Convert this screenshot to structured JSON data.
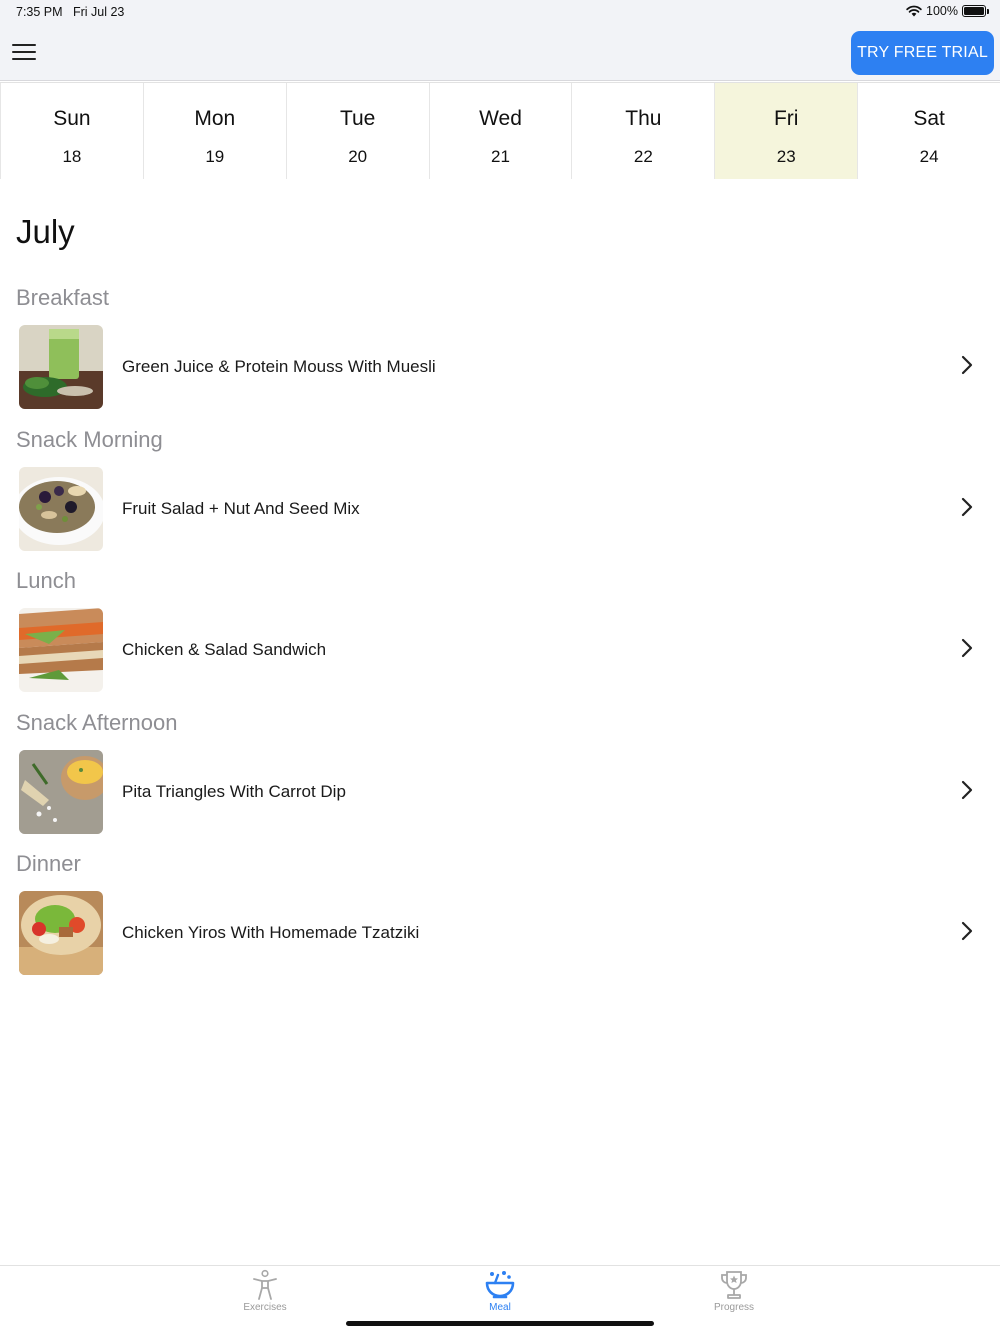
{
  "status": {
    "time": "7:35 PM",
    "date": "Fri Jul 23",
    "battery": "100%",
    "battery_level": 1.0
  },
  "header": {
    "menu_icon": "hamburger-menu-icon",
    "trial_button": "TRY FREE TRIAL",
    "accent_color": "#2d80f2"
  },
  "week": {
    "selected_index": 5,
    "selected_color": "#f5f5dc",
    "days": [
      {
        "name": "Sun",
        "num": "18"
      },
      {
        "name": "Mon",
        "num": "19"
      },
      {
        "name": "Tue",
        "num": "20"
      },
      {
        "name": "Wed",
        "num": "21"
      },
      {
        "name": "Thu",
        "num": "22"
      },
      {
        "name": "Fri",
        "num": "23"
      },
      {
        "name": "Sat",
        "num": "24"
      }
    ]
  },
  "month": "July",
  "meals": [
    {
      "label": "Breakfast",
      "title": "Green Juice & Protein Mouss With Muesli",
      "icon": "green-juice-photo"
    },
    {
      "label": "Snack Morning",
      "title": "Fruit Salad + Nut And Seed Mix",
      "icon": "nut-mix-photo"
    },
    {
      "label": "Lunch",
      "title": "Chicken & Salad Sandwich",
      "icon": "sandwich-photo"
    },
    {
      "label": "Snack Afternoon",
      "title": "Pita Triangles With Carrot Dip",
      "icon": "carrot-dip-photo"
    },
    {
      "label": "Dinner",
      "title": "Chicken Yiros With Homemade Tzatziki",
      "icon": "yiros-photo"
    }
  ],
  "tabs": [
    {
      "label": "Exercises",
      "icon": "exercise-figure-icon"
    },
    {
      "label": "Meal",
      "icon": "meal-bowl-icon",
      "active": true
    },
    {
      "label": "Progress",
      "icon": "trophy-icon"
    }
  ]
}
